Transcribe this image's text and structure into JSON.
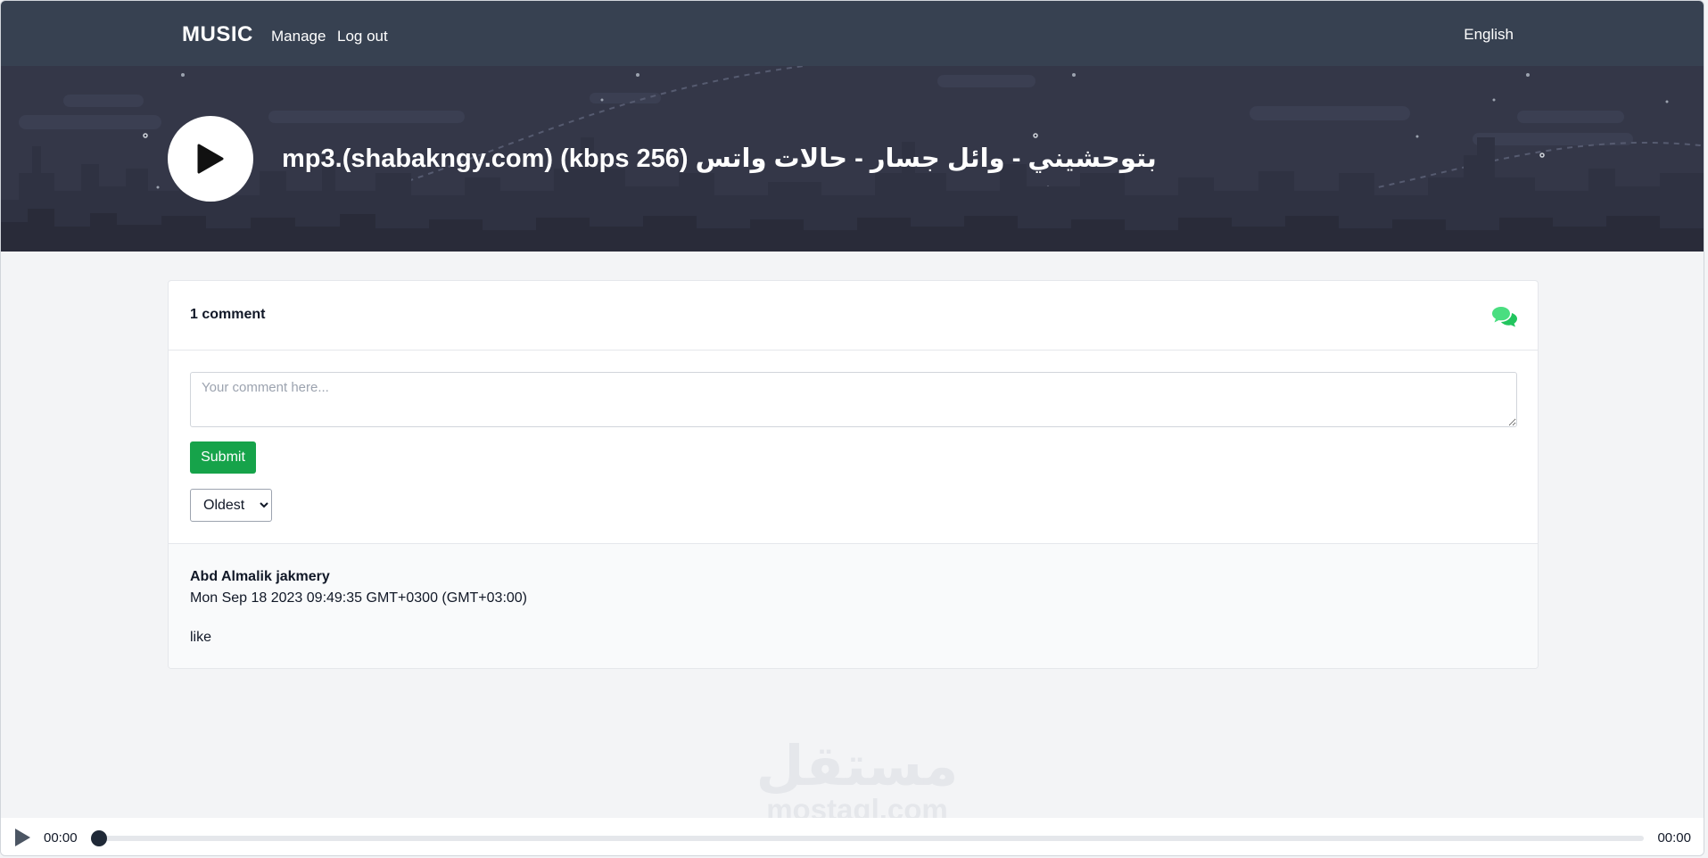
{
  "navbar": {
    "brand": "MUSIC",
    "links": [
      "Manage",
      "Log out"
    ],
    "language": "English"
  },
  "hero": {
    "play_icon": "play-icon",
    "track_title": "بتوحشيني - وائل جسار - حالات واتس (256 kbps) (shabakngy.com).mp3"
  },
  "comments": {
    "count_label": "1 comment",
    "header_icon": "comments-icon",
    "input_placeholder": "Your comment here...",
    "input_value": "",
    "submit_label": "Submit",
    "sort_options": [
      "Oldest"
    ],
    "sort_selected": "Oldest",
    "items": [
      {
        "author": "Abd Almalik jakmery",
        "date": "Mon Sep 18 2023 09:49:35 GMT+0300 (GMT+03:00)",
        "text": "like"
      }
    ]
  },
  "watermark": {
    "arabic": "مستقل",
    "latin": "mostaql.com"
  },
  "player": {
    "play_icon": "play-icon",
    "current_time": "00:00",
    "total_time": "00:00",
    "progress": 0
  },
  "colors": {
    "navbar": "#374151",
    "hero": "#343748",
    "accent_green": "#16a34a",
    "chat_icon": "#4ade80"
  }
}
